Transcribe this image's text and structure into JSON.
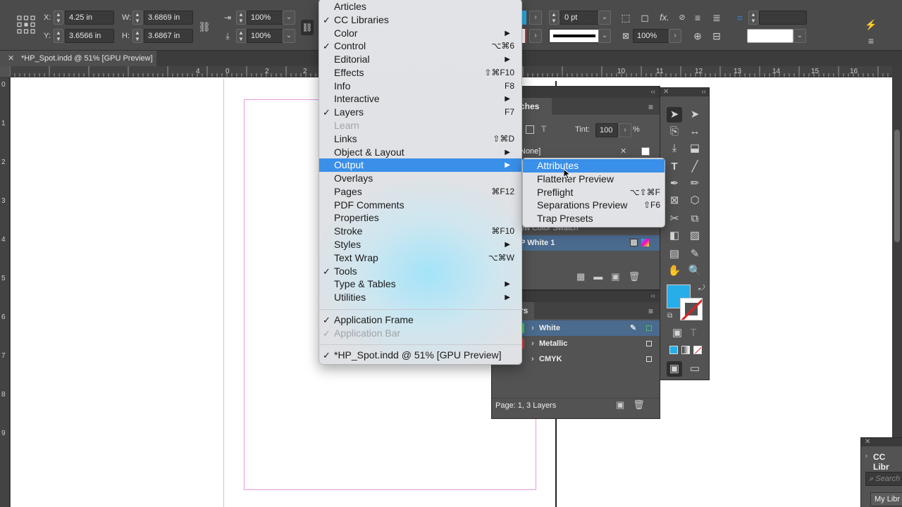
{
  "control_bar": {
    "x_label": "X:",
    "x_value": "4.25 in",
    "y_label": "Y:",
    "y_value": "3.6566 in",
    "w_label": "W:",
    "w_value": "3.6869 in",
    "h_label": "H:",
    "h_value": "3.6867 in",
    "scale_x": "100%",
    "scale_y": "100%",
    "stroke_weight": "0 pt",
    "opacity": "100%",
    "fx_label": "fx."
  },
  "document_tab": {
    "title": "*HP_Spot.indd @ 51% [GPU Preview]",
    "close": "✕"
  },
  "ruler": {
    "h_ticks": [
      "4",
      "2",
      "0",
      "2",
      "10",
      "11",
      "12",
      "13",
      "14",
      "15",
      "16"
    ],
    "v_ticks": [
      "0",
      "1",
      "2",
      "3",
      "4",
      "5",
      "6",
      "7",
      "8",
      "9"
    ]
  },
  "window_menu": {
    "items": [
      {
        "label": "Articles",
        "check": "",
        "shortcut": "",
        "submenu": false,
        "disabled": false
      },
      {
        "label": "CC Libraries",
        "check": "✓",
        "shortcut": "",
        "submenu": false,
        "disabled": false
      },
      {
        "label": "Color",
        "check": "",
        "shortcut": "",
        "submenu": true,
        "disabled": false
      },
      {
        "label": "Control",
        "check": "✓",
        "shortcut": "⌥⌘6",
        "submenu": false,
        "disabled": false
      },
      {
        "label": "Editorial",
        "check": "",
        "shortcut": "",
        "submenu": true,
        "disabled": false
      },
      {
        "label": "Effects",
        "check": "",
        "shortcut": "⇧⌘F10",
        "submenu": false,
        "disabled": false
      },
      {
        "label": "Info",
        "check": "",
        "shortcut": "F8",
        "submenu": false,
        "disabled": false
      },
      {
        "label": "Interactive",
        "check": "",
        "shortcut": "",
        "submenu": true,
        "disabled": false
      },
      {
        "label": "Layers",
        "check": "✓",
        "shortcut": "F7",
        "submenu": false,
        "disabled": false
      },
      {
        "label": "Learn",
        "check": "",
        "shortcut": "",
        "submenu": false,
        "disabled": true
      },
      {
        "label": "Links",
        "check": "",
        "shortcut": "⇧⌘D",
        "submenu": false,
        "disabled": false
      },
      {
        "label": "Object & Layout",
        "check": "",
        "shortcut": "",
        "submenu": true,
        "disabled": false
      },
      {
        "label": "Output",
        "check": "",
        "shortcut": "",
        "submenu": true,
        "disabled": false,
        "selected": true
      },
      {
        "label": "Overlays",
        "check": "",
        "shortcut": "",
        "submenu": false,
        "disabled": false
      },
      {
        "label": "Pages",
        "check": "",
        "shortcut": "⌘F12",
        "submenu": false,
        "disabled": false
      },
      {
        "label": "PDF Comments",
        "check": "",
        "shortcut": "",
        "submenu": false,
        "disabled": false
      },
      {
        "label": "Properties",
        "check": "",
        "shortcut": "",
        "submenu": false,
        "disabled": false
      },
      {
        "label": "Stroke",
        "check": "",
        "shortcut": "⌘F10",
        "submenu": false,
        "disabled": false
      },
      {
        "label": "Styles",
        "check": "",
        "shortcut": "",
        "submenu": true,
        "disabled": false
      },
      {
        "label": "Text Wrap",
        "check": "",
        "shortcut": "⌥⌘W",
        "submenu": false,
        "disabled": false
      },
      {
        "label": "Tools",
        "check": "✓",
        "shortcut": "",
        "submenu": false,
        "disabled": false
      },
      {
        "label": "Type & Tables",
        "check": "",
        "shortcut": "",
        "submenu": true,
        "disabled": false
      },
      {
        "label": "Utilities",
        "check": "",
        "shortcut": "",
        "submenu": true,
        "disabled": false
      }
    ],
    "bottom_items": [
      {
        "label": "Application Frame",
        "check": "✓",
        "disabled": false
      },
      {
        "label": "Application Bar",
        "check": "✓",
        "disabled": true
      }
    ],
    "document_item": {
      "label": "*HP_Spot.indd @ 51% [GPU Preview]",
      "check": "✓"
    }
  },
  "output_submenu": {
    "items": [
      {
        "label": "Attributes",
        "shortcut": "",
        "selected": true
      },
      {
        "label": "Flattener Preview",
        "shortcut": ""
      },
      {
        "label": "Preflight",
        "shortcut": "⌥⇧⌘F"
      },
      {
        "label": "Separations Preview",
        "shortcut": "⇧F6"
      },
      {
        "label": "Trap Presets",
        "shortcut": ""
      }
    ]
  },
  "swatches_panel": {
    "tab": "ches",
    "tint_label": "Tint:",
    "tint_value": "100",
    "tint_unit": "%",
    "rows": [
      "None]",
      "ew Color Swatch",
      "P White 1"
    ]
  },
  "layers_panel": {
    "tab": "rs",
    "layers": [
      {
        "name": "White",
        "color": "#4bbf5a"
      },
      {
        "name": "Metallic",
        "color": "#d13b3b"
      },
      {
        "name": "CMYK",
        "color": "#3b6fd1"
      }
    ],
    "status": "Page: 1, 3 Layers"
  },
  "cc_libraries_panel": {
    "title": "CC Libr",
    "search_placeholder": "Search",
    "library": "My Libr"
  },
  "colors": {
    "menu_highlight": "#3a8fe8",
    "fill_swatch": "#27aee8"
  }
}
